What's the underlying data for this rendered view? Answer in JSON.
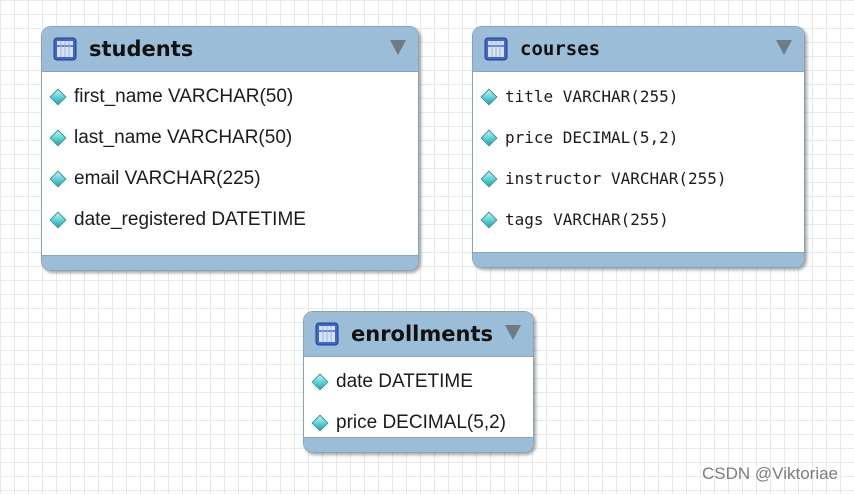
{
  "tables": {
    "students": {
      "title": "students",
      "columns": [
        "first_name VARCHAR(50)",
        "last_name VARCHAR(50)",
        "email VARCHAR(225)",
        "date_registered DATETIME"
      ]
    },
    "courses": {
      "title": "courses",
      "columns": [
        "title VARCHAR(255)",
        "price DECIMAL(5,2)",
        "instructor VARCHAR(255)",
        "tags VARCHAR(255)"
      ]
    },
    "enrollments": {
      "title": "enrollments",
      "columns": [
        "date DATETIME",
        "price DECIMAL(5,2)"
      ]
    }
  },
  "icons": {
    "table": "table-icon",
    "collapse": "collapse-arrow-icon",
    "column": "column-diamond-icon"
  },
  "colors": {
    "header": "#9bbdd8",
    "border": "#8aa3b8",
    "grid": "#e9e9e9",
    "diamond": "#5ccfd0"
  },
  "watermark": "CSDN @Viktoriae"
}
